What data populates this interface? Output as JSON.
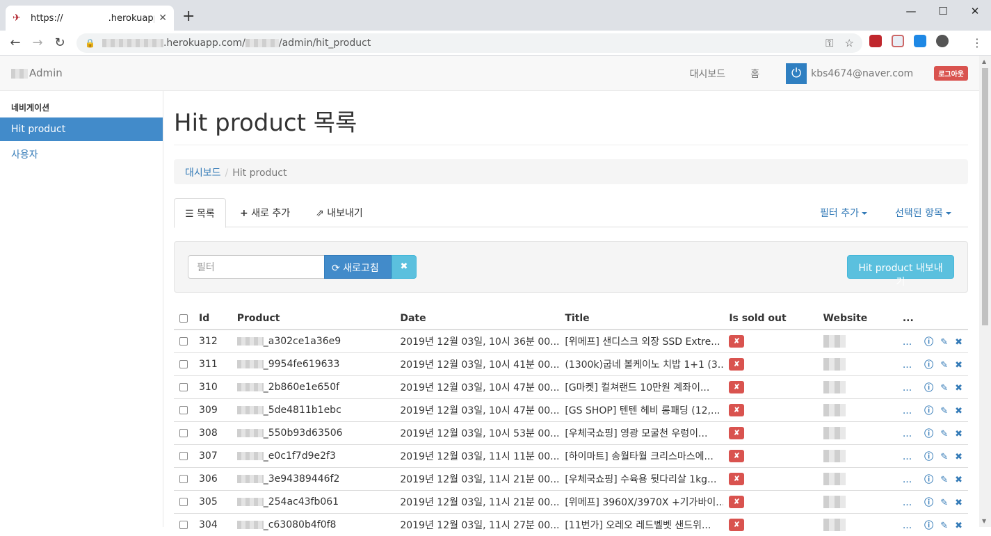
{
  "browser": {
    "tab_title": "https://     .herokuapp",
    "url_host": ".herokuapp.com/",
    "url_path": "/admin/hit_product"
  },
  "navbar": {
    "brand": "Admin",
    "links": [
      "대시보드",
      "홈"
    ],
    "user_email": "kbs4674@naver.com",
    "logout": "로그아웃"
  },
  "sidebar": {
    "header": "네비게이션",
    "items": [
      "Hit product",
      "사용자"
    ]
  },
  "page_title": "Hit product 목록",
  "breadcrumb": {
    "home": "대시보드",
    "current": "Hit product"
  },
  "tabs": {
    "list": "목록",
    "new": "새로 추가",
    "export": "내보내기",
    "add_filter": "필터 추가",
    "selected": "선택된 항목"
  },
  "filter": {
    "placeholder": "필터",
    "refresh": "새로고침",
    "export_button": "Hit product 내보내기"
  },
  "table": {
    "headers": [
      "Id",
      "Product",
      "Date",
      "Title",
      "Is sold out",
      "Website",
      "..."
    ],
    "rows": [
      {
        "id": "312",
        "product": "_a302ce1a36e9",
        "date": "2019년 12월 03일, 10시 36분 00...",
        "title": "[위메프] 샌디스크 외장 SSD Extre..."
      },
      {
        "id": "311",
        "product": "_9954fe619633",
        "date": "2019년 12월 03일, 10시 41분 00...",
        "title": "(1300k)굽네 볼케이노 치밥 1+1 (3..."
      },
      {
        "id": "310",
        "product": "_2b860e1e650f",
        "date": "2019년 12월 03일, 10시 47분 00...",
        "title": "[G마켓] 컬쳐랜드 10만원 계좌이..."
      },
      {
        "id": "309",
        "product": "_5de4811b1ebc",
        "date": "2019년 12월 03일, 10시 47분 00...",
        "title": "[GS SHOP] 텐텐 헤비 롱패딩 (12,..."
      },
      {
        "id": "308",
        "product": "_550b93d63506",
        "date": "2019년 12월 03일, 10시 53분 00...",
        "title": "[우체국쇼핑] 영광 모굴천 우렁이..."
      },
      {
        "id": "307",
        "product": "_e0c1f7d9e2f3",
        "date": "2019년 12월 03일, 11시 11분 00...",
        "title": "[하이마트] 송월타월 크리스마스에..."
      },
      {
        "id": "306",
        "product": "_3e94389446f2",
        "date": "2019년 12월 03일, 11시 21분 00...",
        "title": "[우체국쇼핑] 수육용 뒷다리살 1kg..."
      },
      {
        "id": "305",
        "product": "_254ac43fb061",
        "date": "2019년 12월 03일, 11시 21분 00...",
        "title": "[위메프] 3960X/3970X +기가바이..."
      },
      {
        "id": "304",
        "product": "_c63080b4f0f8",
        "date": "2019년 12월 03일, 11시 27분 00...",
        "title": "[11번가] 오레오 레드벨벳 샌드위..."
      }
    ],
    "sold_out_mark": "✘",
    "row_more": "..."
  }
}
